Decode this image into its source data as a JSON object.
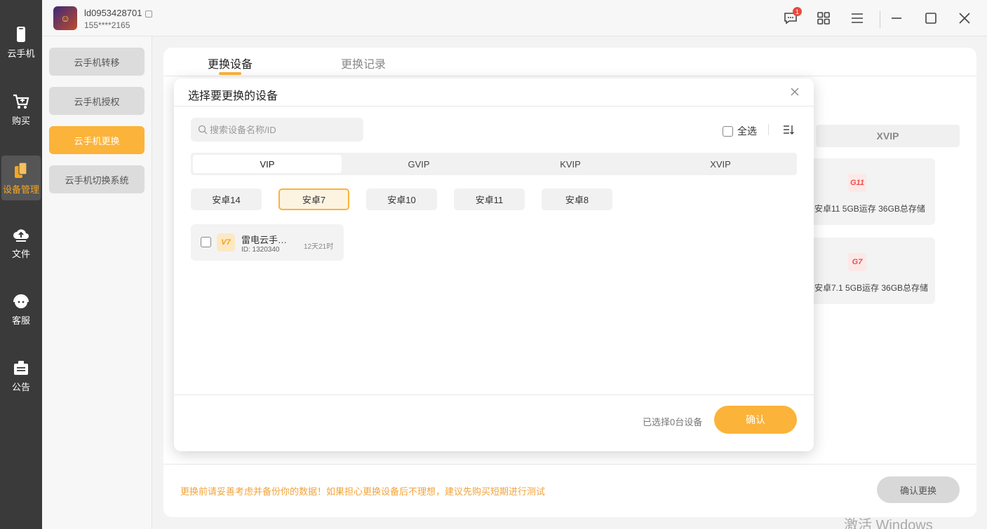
{
  "nav": [
    {
      "label": "云手机",
      "icon": "phone-icon"
    },
    {
      "label": "购买",
      "icon": "cart-icon"
    },
    {
      "label": "设备管理",
      "icon": "device-manage-icon"
    },
    {
      "label": "文件",
      "icon": "cloud-upload-icon"
    },
    {
      "label": "客服",
      "icon": "support-icon"
    },
    {
      "label": "公告",
      "icon": "announcement-icon"
    }
  ],
  "user": {
    "name": "ld0953428701",
    "phone": "155****2165",
    "notification_count": "1"
  },
  "sub_menu": [
    {
      "label": "云手机转移"
    },
    {
      "label": "云手机授权"
    },
    {
      "label": "云手机更换"
    },
    {
      "label": "云手机切换系统"
    }
  ],
  "tabs": [
    {
      "label": "更换设备"
    },
    {
      "label": "更换记录"
    }
  ],
  "background": {
    "tier_label": "XVIP",
    "cards": [
      {
        "badge": "G11",
        "desc": "安卓11 5GB运存 36GB总存储"
      },
      {
        "badge": "G7",
        "desc": "安卓7.1 5GB运存 36GB总存储"
      }
    ],
    "warning": "更换前请妥善考虑并备份你的数据！如果担心更换设备后不理想，建议先购买短期进行测试",
    "confirm_change": "确认更换"
  },
  "modal": {
    "title": "选择要更换的设备",
    "search_placeholder": "搜索设备名称/ID",
    "select_all": "全选",
    "tiers": [
      "VIP",
      "GVIP",
      "KVIP",
      "XVIP"
    ],
    "versions": [
      "安卓14",
      "安卓7",
      "安卓10",
      "安卓11",
      "安卓8"
    ],
    "device": {
      "badge": "V7",
      "name": "雷电云手…",
      "id": "ID: 1320340",
      "time": "12天21时"
    },
    "selected_text": "已选择0台设备",
    "confirm": "确认"
  },
  "watermark": "激活 Windows",
  "colors": {
    "accent": "#fbb33a",
    "nav_bg": "#3a3a3a",
    "warning": "#f2a33a"
  }
}
